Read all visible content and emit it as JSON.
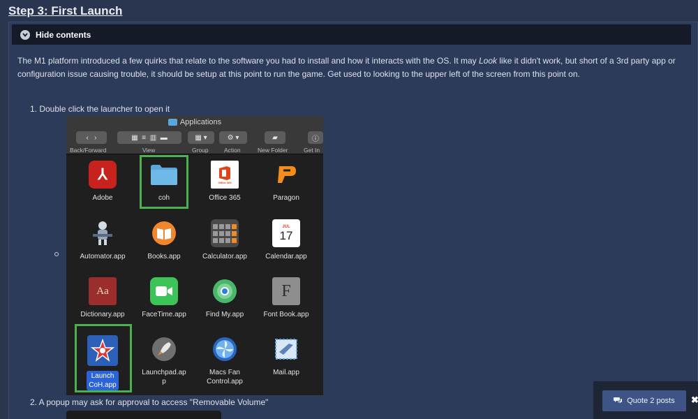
{
  "step_title": "Step 3: First Launch",
  "spoiler": {
    "label": "Hide contents"
  },
  "intro": {
    "part1": "The M1 platform introduced a few quirks that relate to the software you had to install and how it interacts with the OS. It may ",
    "emphasis": "Look",
    "part2": " like it didn't work, but short of a 3rd party app or configuration issue causing trouble, it should be setup at this point to run the game. Get used to looking to the upper left of the screen from this point on."
  },
  "steps": [
    "1.  Double click the launcher to open it",
    "2.  A popup may ask for approval to access \"Removable Volume\""
  ],
  "finder": {
    "window_title": "Applications",
    "toolbar_labels": {
      "back_forward": "Back/Forward",
      "view": "View",
      "group": "Group",
      "action": "Action",
      "new_folder": "New Folder",
      "get_info": "Get In"
    },
    "apps": [
      {
        "name": "Adobe",
        "icon": "adobe-icon",
        "color": "#c8221f"
      },
      {
        "name": "coh",
        "icon": "folder-icon",
        "color": "#5aa7dc"
      },
      {
        "name": "Office 365",
        "icon": "office-icon",
        "color": "#ffffff"
      },
      {
        "name": "Paragon",
        "icon": "paragon-icon",
        "color": "#f28c1b"
      },
      {
        "name": "Automator.app",
        "icon": "automator-icon",
        "color": "#8d9bb0"
      },
      {
        "name": "Books.app",
        "icon": "books-icon",
        "color": "#f0872c"
      },
      {
        "name": "Calculator.app",
        "icon": "calculator-icon",
        "color": "#6d6d6d"
      },
      {
        "name": "Calendar.app",
        "icon": "calendar-icon",
        "color": "#ffffff"
      },
      {
        "name": "Dictionary.app",
        "icon": "dictionary-icon",
        "color": "#9b2d2d"
      },
      {
        "name": "FaceTime.app",
        "icon": "facetime-icon",
        "color": "#3cc458"
      },
      {
        "name": "Find My.app",
        "icon": "findmy-icon",
        "color": "#4ab66b"
      },
      {
        "name": "Font Book.app",
        "icon": "fontbook-icon",
        "color": "#9a9a9a"
      },
      {
        "name": "Launch CoH.app",
        "icon": "launch-coh-icon",
        "color": "#2c5fb8"
      },
      {
        "name": "Launchpad.app",
        "icon": "launchpad-icon",
        "color": "#7c7c7c"
      },
      {
        "name": "Macs Fan Control.app",
        "icon": "fan-icon",
        "color": "#3b7fd4"
      },
      {
        "name": "Mail.app",
        "icon": "mail-icon",
        "color": "#5fa0e0"
      }
    ],
    "name_lines": {
      "launch_coh": [
        "Launch",
        "CoH.app"
      ],
      "launchpad": [
        "Launchpad.ap",
        "p"
      ],
      "macs_fan": [
        "Macs Fan",
        "Control.app"
      ]
    },
    "glyphs": {
      "adobe": "⅄",
      "office_sub": "Office 365",
      "calendar_month": "JUL",
      "calendar_day": "17",
      "dictionary": "Aa",
      "fontbook": "F"
    }
  },
  "quote_button": {
    "label": "Quote 2 posts",
    "icon": "comments-icon"
  },
  "close": {
    "label": "✖"
  },
  "colors": {
    "page_bg": "#2a3650",
    "spoiler_bg": "#141a28",
    "highlight": "#4caf50",
    "quote_bg": "#3f5486"
  }
}
